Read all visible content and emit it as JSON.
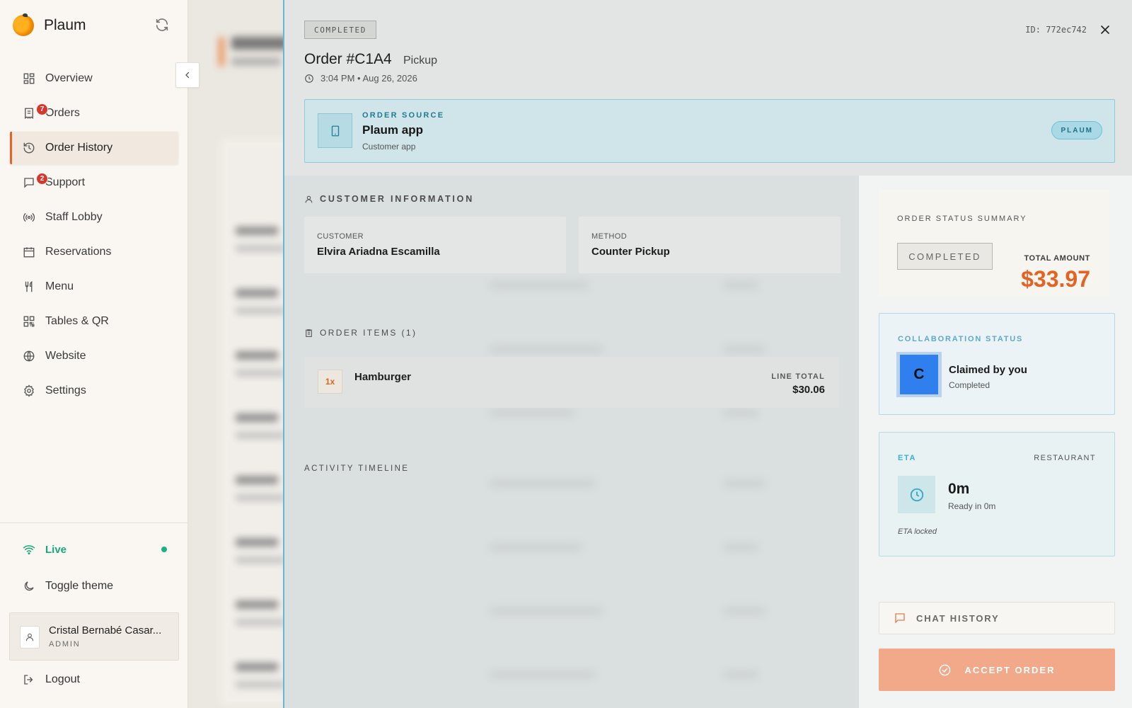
{
  "sidebar": {
    "brand": "Plaum",
    "nav": [
      {
        "label": "Overview",
        "icon": "grid-icon"
      },
      {
        "label": "Orders",
        "icon": "orders-icon",
        "badge": "7"
      },
      {
        "label": "Order History",
        "icon": "history-icon",
        "active": true
      },
      {
        "label": "Support",
        "icon": "chat-icon",
        "badge": "2"
      },
      {
        "label": "Staff Lobby",
        "icon": "broadcast-icon"
      },
      {
        "label": "Reservations",
        "icon": "calendar-icon"
      },
      {
        "label": "Menu",
        "icon": "utensils-icon"
      },
      {
        "label": "Tables & QR",
        "icon": "qr-icon"
      },
      {
        "label": "Website",
        "icon": "globe-icon"
      },
      {
        "label": "Settings",
        "icon": "gear-icon"
      }
    ],
    "live_label": "Live",
    "toggle_theme": "Toggle theme",
    "user": {
      "name": "Cristal Bernabé Casar...",
      "role": "ADMIN"
    },
    "logout": "Logout"
  },
  "order": {
    "status": "COMPLETED",
    "id_label": "ID: 772ec742",
    "title": "Order #C1A4",
    "type": "Pickup",
    "time": "3:04 PM • Aug 26, 2026"
  },
  "source": {
    "kicker": "ORDER SOURCE",
    "name": "Plaum app",
    "sub": "Customer app",
    "pill": "PLAUM"
  },
  "customer": {
    "heading": "CUSTOMER INFORMATION",
    "customer_label": "CUSTOMER",
    "customer_value": "Elvira Ariadna Escamilla",
    "method_label": "METHOD",
    "method_value": "Counter Pickup"
  },
  "items": {
    "heading": "ORDER ITEMS (1)",
    "list": [
      {
        "qty": "1x",
        "name": "Hamburger",
        "line_label": "LINE TOTAL",
        "line_total": "$30.06"
      }
    ]
  },
  "activity": {
    "heading": "ACTIVITY TIMELINE"
  },
  "summary": {
    "label": "ORDER STATUS SUMMARY",
    "status": "COMPLETED",
    "total_label": "TOTAL AMOUNT",
    "total": "$33.97"
  },
  "collaboration": {
    "kicker": "COLLABORATION STATUS",
    "initial": "C",
    "title": "Claimed by you",
    "sub": "Completed"
  },
  "eta": {
    "kicker": "ETA",
    "right_label": "RESTAURANT",
    "value": "0m",
    "sub": "Ready in 0m",
    "lock": "ETA locked"
  },
  "actions": {
    "chat": "CHAT HISTORY",
    "accept": "ACCEPT ORDER"
  },
  "colors": {
    "accent": "#e8622a",
    "live": "#15a97b",
    "source_accent": "#217a93",
    "total": "#e66223"
  }
}
